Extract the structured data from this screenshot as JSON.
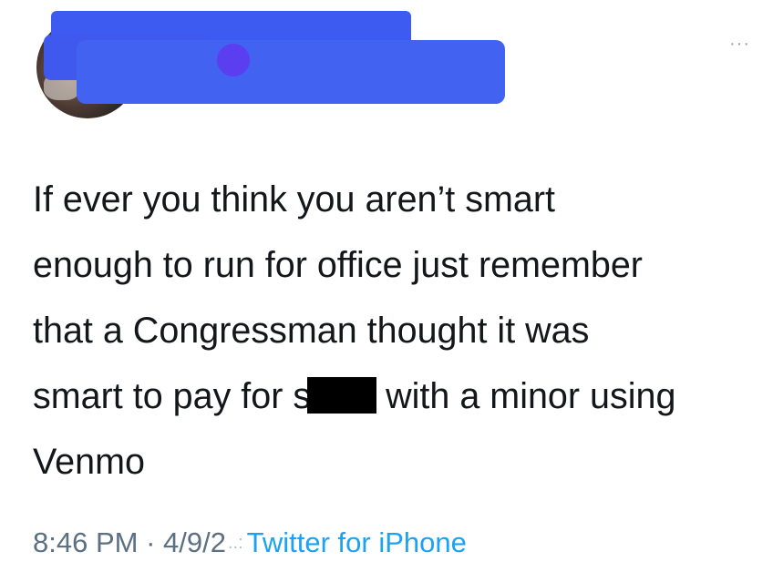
{
  "header": {
    "more_glyph": "···"
  },
  "tweet": {
    "lines": [
      "If ever you think you aren’t smart",
      "enough to run for office just remember",
      "that a Congressman thought it was"
    ],
    "line4_before": "smart to pay for s",
    "line4_after": "with a minor using",
    "line5": "Venmo"
  },
  "meta": {
    "time": "8:46 PM",
    "separator": " · ",
    "date": "4/9/2",
    "date_smudge": "..:",
    "source": "Twitter for iPhone"
  },
  "colors": {
    "redaction_blue": "#3d5bf0",
    "text": "#14171a",
    "meta_gray": "#5b7083",
    "link_blue": "#1da1f2"
  }
}
